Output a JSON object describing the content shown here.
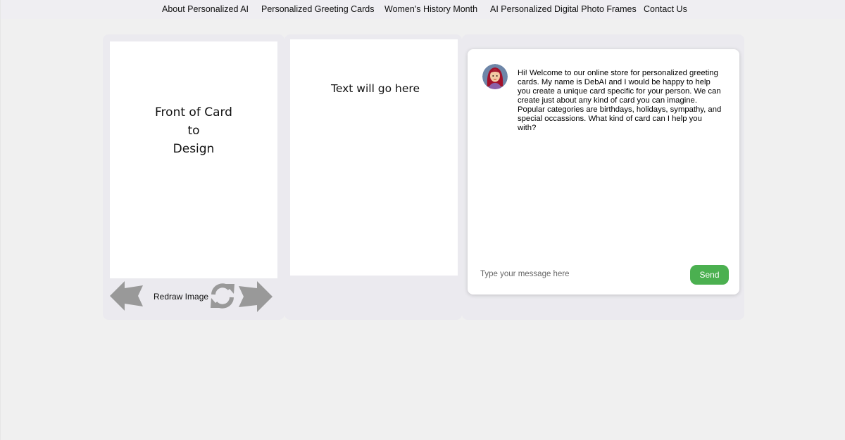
{
  "nav": {
    "items": [
      {
        "label": "About Personalized AI"
      },
      {
        "label": "Personalized Greeting Cards"
      },
      {
        "label": "Women's History Month"
      },
      {
        "label": "AI Personalized Digital Photo Frames"
      },
      {
        "label": "Contact Us"
      }
    ]
  },
  "card_front": {
    "text": "Front of Card\nto\nDesign"
  },
  "card_inside": {
    "text": "Text will go here"
  },
  "controls": {
    "prev_icon": "arrow-left-icon",
    "redraw_label": "Redraw Image",
    "redraw_icon": "refresh-icon",
    "next_icon": "arrow-right-icon"
  },
  "chat": {
    "avatar_icon": "assistant-avatar",
    "message": "Hi! Welcome to our online store for personalized greeting cards. My name is DebAI and I would be happy to help you create a unique card specific for your person. We can create just about any kind of card you can imagine. Popular categories are birthdays, holidays, sympathy, and special occassions. What kind of card can I help you with?",
    "input_placeholder": "Type your message here",
    "send_label": "Send"
  },
  "colors": {
    "send_button": "#4bb050",
    "arrow_gray": "#999999",
    "avatar_bg": "#6e86a8",
    "hair": "#a3112a"
  }
}
